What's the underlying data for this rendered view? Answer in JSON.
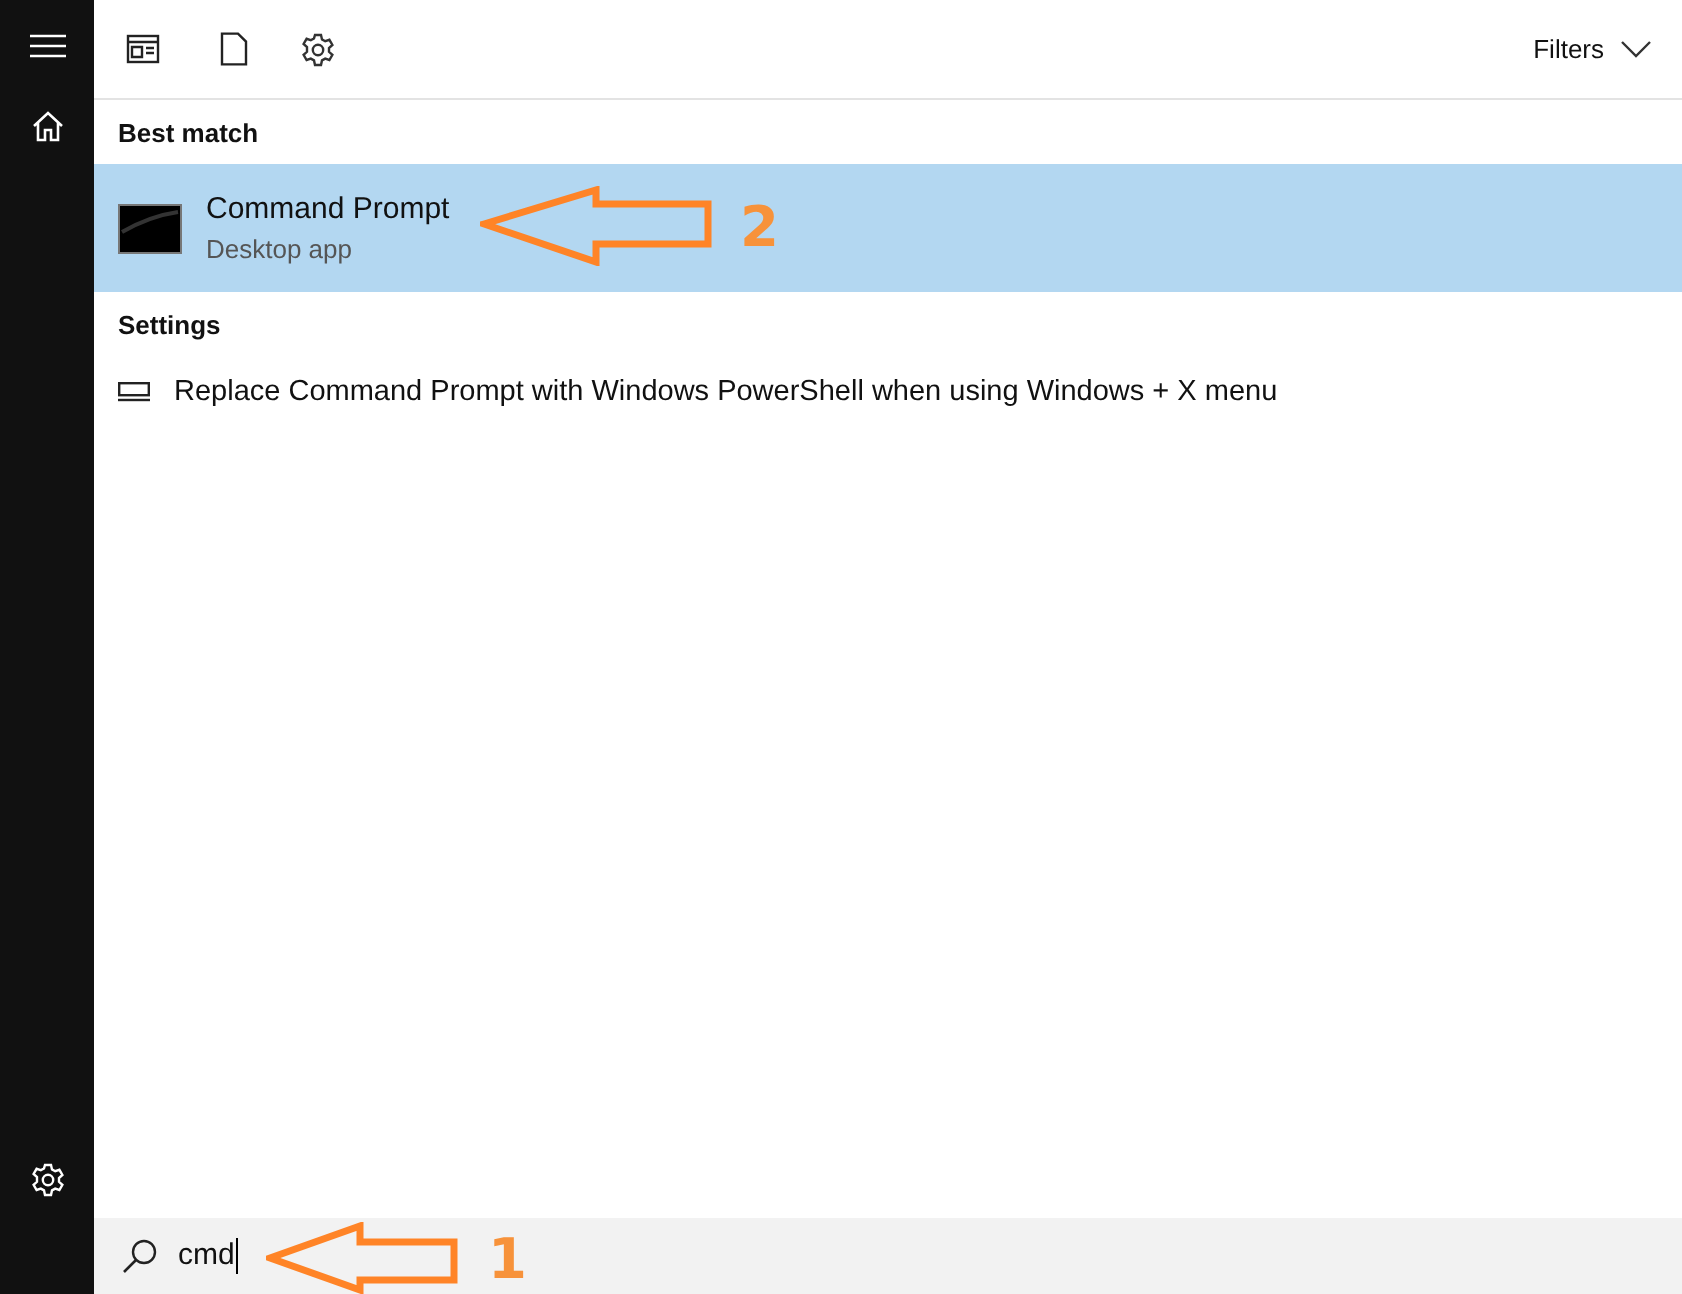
{
  "toolbar": {
    "filters": "Filters"
  },
  "sections": [
    {
      "title": "Best match",
      "items": [
        {
          "kind": "app",
          "title": "Command Prompt",
          "subtitle": "Desktop app",
          "selected": true
        }
      ]
    },
    {
      "title": "Settings",
      "items": [
        {
          "kind": "setting",
          "title": "Replace Command Prompt with Windows PowerShell when using Windows + X menu",
          "selected": false
        }
      ]
    }
  ],
  "search": {
    "value": "cmd"
  },
  "annotations": [
    {
      "label": "2"
    },
    {
      "label": "1"
    }
  ]
}
